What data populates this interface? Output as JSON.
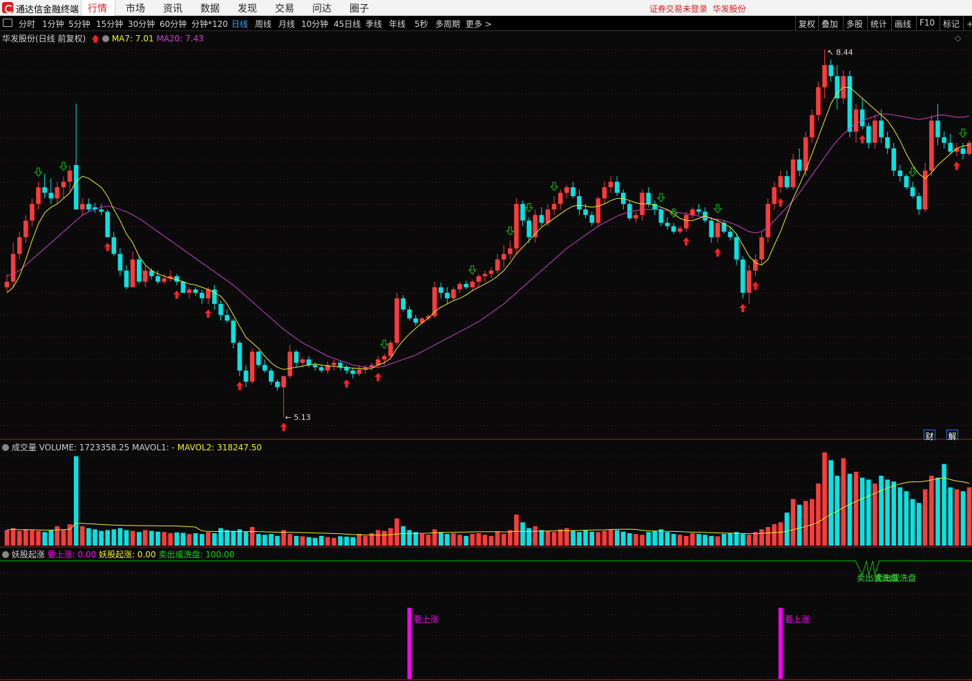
{
  "app": {
    "title": "通达信金融终端",
    "login_status": "证券交易未登录",
    "stock_link": "华发股份"
  },
  "menu": [
    {
      "label": "行情",
      "active": true
    },
    {
      "label": "市场"
    },
    {
      "label": "资讯"
    },
    {
      "label": "数据"
    },
    {
      "label": "发现"
    },
    {
      "label": "交易"
    },
    {
      "label": "问达"
    },
    {
      "label": "圈子"
    }
  ],
  "periods": [
    "分时",
    "1分钟",
    "5分钟",
    "15分钟",
    "30分钟",
    "60分钟",
    "分钟*120",
    "日线",
    "周线",
    "月线",
    "10分钟",
    "45日线",
    "季线",
    "年线",
    "5秒",
    "多周期",
    "更多 >"
  ],
  "active_period": "日线",
  "right_tools": [
    "复权",
    "叠加",
    "多股",
    "统计",
    "画线",
    "F10",
    "标记",
    "+自"
  ],
  "main_panel": {
    "stock": "华发股份(日线 前复权)",
    "ma7_label": "MA7: 7.01",
    "ma20_label": "MA20: 7.43",
    "high_label": "8.44",
    "low_label": "5.13",
    "corner_marks": [
      "财",
      "解"
    ]
  },
  "volume_panel": {
    "title": "成交量",
    "volume_label": "VOLUME: 1723358.25",
    "mavol1_label": "MAVOL1: -",
    "mavol2_label": "MAVOL2: 318247.50"
  },
  "indicator_panel": {
    "title": "妖股起涨",
    "v1_label": "要上涨: 0.00",
    "v2_label": "妖股起涨: 0.00",
    "v3_label": "卖出或洗盘: 100.00",
    "signal_rise": "要上涨",
    "signal_sell": "卖出或洗盘"
  },
  "colors": {
    "up": "#ff3b3b",
    "down": "#00e5e5",
    "ma7": "#f0f020",
    "ma20": "#d040d0",
    "signal": "#ff00ff",
    "sell_line": "#00c800",
    "buy_arrow": "#ff2020",
    "sell_arrow": "#00d000"
  },
  "chart_data": {
    "type": "candlestick",
    "price_range": [
      5.0,
      8.5
    ],
    "high": 8.44,
    "low": 5.13,
    "ohlc": [
      [
        6.3,
        6.42,
        6.26,
        6.35
      ],
      [
        6.35,
        6.7,
        6.3,
        6.6
      ],
      [
        6.6,
        6.8,
        6.55,
        6.75
      ],
      [
        6.75,
        6.95,
        6.7,
        6.9
      ],
      [
        6.9,
        7.1,
        6.85,
        7.05
      ],
      [
        7.05,
        7.25,
        7.0,
        7.2
      ],
      [
        7.2,
        7.32,
        7.1,
        7.15
      ],
      [
        7.15,
        7.28,
        7.05,
        7.1
      ],
      [
        7.1,
        7.25,
        7.05,
        7.2
      ],
      [
        7.2,
        7.3,
        7.1,
        7.25
      ],
      [
        7.25,
        7.4,
        7.15,
        7.35
      ],
      [
        7.4,
        7.95,
        7.35,
        7.0
      ],
      [
        7.0,
        7.1,
        6.95,
        7.05
      ],
      [
        7.05,
        7.1,
        6.98,
        7.0
      ],
      [
        7.02,
        7.06,
        6.97,
        7.0
      ],
      [
        7.0,
        7.05,
        6.95,
        6.98
      ],
      [
        6.98,
        7.0,
        6.75,
        6.75
      ],
      [
        6.75,
        6.8,
        6.58,
        6.6
      ],
      [
        6.6,
        6.65,
        6.4,
        6.45
      ],
      [
        6.45,
        6.5,
        6.28,
        6.3
      ],
      [
        6.3,
        6.62,
        6.3,
        6.55
      ],
      [
        6.55,
        6.58,
        6.33,
        6.35
      ],
      [
        6.35,
        6.5,
        6.3,
        6.45
      ],
      [
        6.45,
        6.47,
        6.37,
        6.4
      ],
      [
        6.4,
        6.45,
        6.33,
        6.35
      ],
      [
        6.35,
        6.42,
        6.33,
        6.38
      ],
      [
        6.38,
        6.45,
        6.35,
        6.4
      ],
      [
        6.4,
        6.42,
        6.32,
        6.35
      ],
      [
        6.35,
        6.36,
        6.25,
        6.25
      ],
      [
        6.25,
        6.3,
        6.2,
        6.28
      ],
      [
        6.28,
        6.3,
        6.22,
        6.25
      ],
      [
        6.25,
        6.28,
        6.15,
        6.2
      ],
      [
        6.2,
        6.3,
        6.15,
        6.28
      ],
      [
        6.28,
        6.32,
        6.1,
        6.15
      ],
      [
        6.15,
        6.18,
        6.0,
        6.05
      ],
      [
        6.05,
        6.1,
        5.98,
        6.0
      ],
      [
        6.0,
        6.02,
        5.75,
        5.8
      ],
      [
        5.8,
        5.82,
        5.5,
        5.55
      ],
      [
        5.55,
        5.6,
        5.4,
        5.45
      ],
      [
        5.45,
        5.75,
        5.43,
        5.72
      ],
      [
        5.72,
        5.73,
        5.58,
        5.6
      ],
      [
        5.6,
        5.65,
        5.53,
        5.55
      ],
      [
        5.55,
        5.57,
        5.42,
        5.45
      ],
      [
        5.45,
        5.47,
        5.37,
        5.4
      ],
      [
        5.4,
        5.5,
        5.13,
        5.5
      ],
      [
        5.5,
        5.78,
        5.48,
        5.72
      ],
      [
        5.72,
        5.74,
        5.58,
        5.62
      ],
      [
        5.62,
        5.67,
        5.58,
        5.65
      ],
      [
        5.65,
        5.68,
        5.58,
        5.6
      ],
      [
        5.6,
        5.62,
        5.55,
        5.58
      ],
      [
        5.58,
        5.6,
        5.53,
        5.55
      ],
      [
        5.55,
        5.63,
        5.52,
        5.6
      ],
      [
        5.6,
        5.65,
        5.55,
        5.62
      ],
      [
        5.62,
        5.64,
        5.55,
        5.58
      ],
      [
        5.58,
        5.6,
        5.52,
        5.55
      ],
      [
        5.55,
        5.58,
        5.48,
        5.52
      ],
      [
        5.52,
        5.6,
        5.5,
        5.56
      ],
      [
        5.56,
        5.6,
        5.52,
        5.58
      ],
      [
        5.58,
        5.62,
        5.55,
        5.6
      ],
      [
        5.6,
        5.68,
        5.58,
        5.65
      ],
      [
        5.65,
        5.7,
        5.6,
        5.68
      ],
      [
        5.68,
        5.82,
        5.65,
        5.8
      ],
      [
        5.8,
        6.25,
        5.78,
        6.2
      ],
      [
        6.2,
        6.23,
        6.08,
        6.1
      ],
      [
        6.1,
        6.13,
        6.0,
        6.02
      ],
      [
        6.02,
        6.05,
        5.95,
        5.98
      ],
      [
        5.98,
        6.03,
        5.96,
        6.02
      ],
      [
        6.02,
        6.06,
        6.0,
        6.04
      ],
      [
        6.04,
        6.35,
        6.02,
        6.3
      ],
      [
        6.3,
        6.34,
        6.2,
        6.25
      ],
      [
        6.25,
        6.3,
        6.15,
        6.2
      ],
      [
        6.2,
        6.3,
        6.18,
        6.28
      ],
      [
        6.28,
        6.35,
        6.25,
        6.33
      ],
      [
        6.33,
        6.36,
        6.28,
        6.3
      ],
      [
        6.3,
        6.37,
        6.27,
        6.35
      ],
      [
        6.35,
        6.42,
        6.3,
        6.4
      ],
      [
        6.4,
        6.45,
        6.35,
        6.42
      ],
      [
        6.42,
        6.48,
        6.38,
        6.45
      ],
      [
        6.45,
        6.6,
        6.42,
        6.55
      ],
      [
        6.55,
        6.68,
        6.48,
        6.6
      ],
      [
        6.6,
        6.72,
        6.55,
        6.65
      ],
      [
        6.65,
        7.1,
        6.6,
        7.05
      ],
      [
        7.05,
        7.08,
        6.85,
        6.9
      ],
      [
        6.9,
        6.93,
        6.7,
        6.75
      ],
      [
        6.75,
        7.0,
        6.7,
        6.95
      ],
      [
        6.95,
        7.02,
        6.85,
        6.88
      ],
      [
        6.88,
        7.05,
        6.85,
        7.0
      ],
      [
        7.0,
        7.12,
        6.95,
        7.05
      ],
      [
        7.05,
        7.18,
        7.0,
        7.15
      ],
      [
        7.15,
        7.22,
        7.1,
        7.2
      ],
      [
        7.2,
        7.25,
        7.1,
        7.12
      ],
      [
        7.12,
        7.18,
        6.95,
        7.0
      ],
      [
        7.0,
        7.05,
        6.92,
        6.95
      ],
      [
        6.95,
        6.98,
        6.85,
        6.88
      ],
      [
        6.88,
        7.12,
        6.85,
        7.1
      ],
      [
        7.1,
        7.25,
        7.05,
        7.2
      ],
      [
        7.2,
        7.3,
        7.15,
        7.25
      ],
      [
        7.25,
        7.3,
        7.12,
        7.15
      ],
      [
        7.15,
        7.18,
        7.0,
        7.05
      ],
      [
        7.05,
        7.08,
        6.9,
        6.92
      ],
      [
        6.92,
        6.98,
        6.88,
        6.95
      ],
      [
        6.95,
        7.18,
        6.9,
        7.15
      ],
      [
        7.15,
        7.2,
        7.02,
        7.05
      ],
      [
        7.05,
        7.08,
        6.95,
        7.0
      ],
      [
        7.0,
        7.02,
        6.85,
        6.88
      ],
      [
        6.88,
        6.93,
        6.82,
        6.85
      ],
      [
        6.85,
        6.88,
        6.78,
        6.8
      ],
      [
        6.8,
        6.85,
        6.78,
        6.83
      ],
      [
        6.83,
        6.98,
        6.8,
        6.95
      ],
      [
        6.95,
        7.02,
        6.92,
        7.0
      ],
      [
        7.0,
        7.05,
        6.95,
        6.98
      ],
      [
        6.98,
        7.02,
        6.88,
        6.9
      ],
      [
        6.9,
        6.93,
        6.7,
        6.75
      ],
      [
        6.75,
        6.92,
        6.7,
        6.88
      ],
      [
        6.88,
        6.9,
        6.78,
        6.8
      ],
      [
        6.8,
        6.85,
        6.72,
        6.75
      ],
      [
        6.75,
        6.78,
        6.5,
        6.55
      ],
      [
        6.55,
        6.58,
        6.2,
        6.25
      ],
      [
        6.25,
        6.5,
        6.15,
        6.45
      ],
      [
        6.45,
        6.6,
        6.4,
        6.55
      ],
      [
        6.55,
        6.8,
        6.5,
        6.75
      ],
      [
        6.75,
        7.1,
        6.7,
        7.05
      ],
      [
        7.05,
        7.25,
        7.0,
        7.2
      ],
      [
        7.2,
        7.35,
        7.15,
        7.3
      ],
      [
        7.3,
        7.35,
        7.18,
        7.2
      ],
      [
        7.2,
        7.5,
        7.18,
        7.45
      ],
      [
        7.45,
        7.55,
        7.3,
        7.35
      ],
      [
        7.35,
        7.7,
        7.3,
        7.65
      ],
      [
        7.65,
        7.9,
        7.6,
        7.85
      ],
      [
        7.85,
        8.15,
        7.8,
        8.1
      ],
      [
        8.1,
        8.44,
        8.0,
        8.3
      ],
      [
        8.3,
        8.35,
        8.15,
        8.2
      ],
      [
        8.2,
        8.3,
        7.9,
        8.0
      ],
      [
        8.0,
        8.25,
        7.95,
        8.2
      ],
      [
        8.2,
        8.25,
        7.65,
        7.7
      ],
      [
        7.7,
        7.95,
        7.6,
        7.9
      ],
      [
        7.9,
        8.0,
        7.72,
        7.75
      ],
      [
        7.75,
        7.78,
        7.55,
        7.6
      ],
      [
        7.6,
        7.85,
        7.55,
        7.8
      ],
      [
        7.8,
        7.9,
        7.6,
        7.65
      ],
      [
        7.65,
        7.7,
        7.5,
        7.55
      ],
      [
        7.55,
        7.6,
        7.3,
        7.35
      ],
      [
        7.35,
        7.4,
        7.25,
        7.3
      ],
      [
        7.3,
        7.32,
        7.18,
        7.2
      ],
      [
        7.2,
        7.25,
        7.1,
        7.12
      ],
      [
        7.12,
        7.15,
        6.95,
        7.0
      ],
      [
        7.0,
        7.42,
        6.98,
        7.35
      ],
      [
        7.35,
        7.85,
        7.3,
        7.8
      ],
      [
        7.8,
        7.95,
        7.58,
        7.65
      ],
      [
        7.65,
        7.7,
        7.55,
        7.6
      ],
      [
        7.6,
        7.68,
        7.5,
        7.52
      ],
      [
        7.52,
        7.6,
        7.48,
        7.55
      ],
      [
        7.55,
        7.6,
        7.45,
        7.5
      ],
      [
        7.5,
        7.62,
        7.48,
        7.6
      ]
    ],
    "volume": [
      40,
      45,
      38,
      42,
      40,
      38,
      35,
      40,
      50,
      42,
      55,
      230,
      50,
      45,
      42,
      38,
      40,
      42,
      45,
      40,
      38,
      35,
      40,
      38,
      36,
      35,
      32,
      34,
      33,
      30,
      32,
      30,
      35,
      32,
      45,
      40,
      38,
      42,
      35,
      48,
      30,
      28,
      30,
      25,
      40,
      30,
      25,
      24,
      22,
      20,
      25,
      22,
      20,
      24,
      23,
      22,
      30,
      25,
      32,
      40,
      38,
      45,
      70,
      50,
      40,
      35,
      30,
      28,
      42,
      35,
      30,
      32,
      28,
      25,
      30,
      32,
      28,
      25,
      35,
      30,
      40,
      80,
      60,
      45,
      50,
      40,
      38,
      35,
      42,
      45,
      38,
      35,
      40,
      36,
      35,
      38,
      42,
      40,
      36,
      32,
      30,
      28,
      35,
      38,
      42,
      35,
      30,
      28,
      25,
      32,
      30,
      28,
      25,
      24,
      30,
      32,
      35,
      30,
      28,
      35,
      42,
      48,
      55,
      60,
      85,
      120,
      105,
      115,
      120,
      160,
      240,
      220,
      180,
      225,
      185,
      190,
      175,
      170,
      160,
      180,
      170,
      165,
      150,
      140,
      120,
      110,
      145,
      180,
      175,
      210,
      150,
      145,
      140,
      150
    ],
    "ma7": [
      6.25,
      6.3,
      6.4,
      6.55,
      6.72,
      6.87,
      6.97,
      7.02,
      7.05,
      7.1,
      7.15,
      7.25,
      7.3,
      7.28,
      7.24,
      7.2,
      7.12,
      7.0,
      6.9,
      6.78,
      6.7,
      6.58,
      6.5,
      6.45,
      6.42,
      6.4,
      6.38,
      6.37,
      6.35,
      6.33,
      6.32,
      6.3,
      6.28,
      6.25,
      6.22,
      6.15,
      6.05,
      5.95,
      5.85,
      5.8,
      5.75,
      5.68,
      5.62,
      5.58,
      5.56,
      5.57,
      5.58,
      5.59,
      5.6,
      5.61,
      5.6,
      5.59,
      5.59,
      5.58,
      5.58,
      5.57,
      5.57,
      5.56,
      5.57,
      5.6,
      5.62,
      5.66,
      5.75,
      5.82,
      5.88,
      5.93,
      5.98,
      6.02,
      6.08,
      6.12,
      6.15,
      6.18,
      6.2,
      6.23,
      6.27,
      6.3,
      6.33,
      6.36,
      6.4,
      6.45,
      6.52,
      6.6,
      6.66,
      6.72,
      6.78,
      6.84,
      6.88,
      6.92,
      6.96,
      7.0,
      7.03,
      7.04,
      7.03,
      7.02,
      7.03,
      7.05,
      7.08,
      7.1,
      7.1,
      7.08,
      7.06,
      7.05,
      7.05,
      7.04,
      7.02,
      7.0,
      6.96,
      6.92,
      6.9,
      6.9,
      6.92,
      6.94,
      6.92,
      6.9,
      6.87,
      6.84,
      6.78,
      6.68,
      6.58,
      6.52,
      6.5,
      6.55,
      6.68,
      6.8,
      6.95,
      7.1,
      7.22,
      7.35,
      7.5,
      7.65,
      7.8,
      7.95,
      8.05,
      8.1,
      8.1,
      8.05,
      8.0,
      7.95,
      7.9,
      7.85,
      7.8,
      7.72,
      7.62,
      7.5,
      7.4,
      7.32,
      7.28,
      7.33,
      7.4,
      7.45,
      7.5,
      7.55,
      7.57,
      7.58
    ],
    "ma20": [
      6.4,
      6.42,
      6.45,
      6.5,
      6.55,
      6.6,
      6.65,
      6.7,
      6.75,
      6.8,
      6.85,
      6.9,
      6.95,
      6.98,
      7.0,
      7.02,
      7.03,
      7.02,
      7.0,
      6.98,
      6.95,
      6.92,
      6.88,
      6.84,
      6.8,
      6.76,
      6.72,
      6.68,
      6.64,
      6.6,
      6.56,
      6.52,
      6.48,
      6.44,
      6.4,
      6.36,
      6.32,
      6.27,
      6.22,
      6.17,
      6.12,
      6.07,
      6.02,
      5.97,
      5.92,
      5.88,
      5.84,
      5.8,
      5.77,
      5.74,
      5.71,
      5.68,
      5.66,
      5.64,
      5.62,
      5.6,
      5.59,
      5.58,
      5.58,
      5.58,
      5.59,
      5.61,
      5.63,
      5.65,
      5.67,
      5.69,
      5.72,
      5.75,
      5.78,
      5.81,
      5.84,
      5.87,
      5.9,
      5.93,
      5.96,
      5.99,
      6.03,
      6.07,
      6.11,
      6.15,
      6.2,
      6.25,
      6.3,
      6.35,
      6.4,
      6.45,
      6.5,
      6.55,
      6.6,
      6.65,
      6.69,
      6.73,
      6.77,
      6.81,
      6.85,
      6.88,
      6.91,
      6.94,
      6.96,
      6.98,
      6.99,
      7.0,
      7.0,
      7.0,
      7.0,
      6.99,
      6.98,
      6.97,
      6.96,
      6.95,
      6.94,
      6.93,
      6.92,
      6.91,
      6.9,
      6.88,
      6.86,
      6.83,
      6.8,
      6.79,
      6.8,
      6.84,
      6.9,
      6.96,
      7.02,
      7.08,
      7.15,
      7.23,
      7.31,
      7.39,
      7.47,
      7.55,
      7.62,
      7.68,
      7.73,
      7.77,
      7.8,
      7.82,
      7.84,
      7.86,
      7.86,
      7.85,
      7.84,
      7.83,
      7.82,
      7.81,
      7.82,
      7.83,
      7.85,
      7.85,
      7.84,
      7.83,
      7.83,
      7.84
    ],
    "buy_signals": [
      16,
      27,
      32,
      37,
      44,
      54,
      59,
      108,
      113,
      117,
      119,
      123,
      136,
      151
    ],
    "sell_signals": [
      5,
      9,
      60,
      74,
      80,
      83,
      87,
      104,
      106,
      113,
      144,
      152
    ],
    "rise_signal_index": [
      64,
      123
    ],
    "sell_wash_signal_index": [
      136,
      137,
      138
    ]
  }
}
